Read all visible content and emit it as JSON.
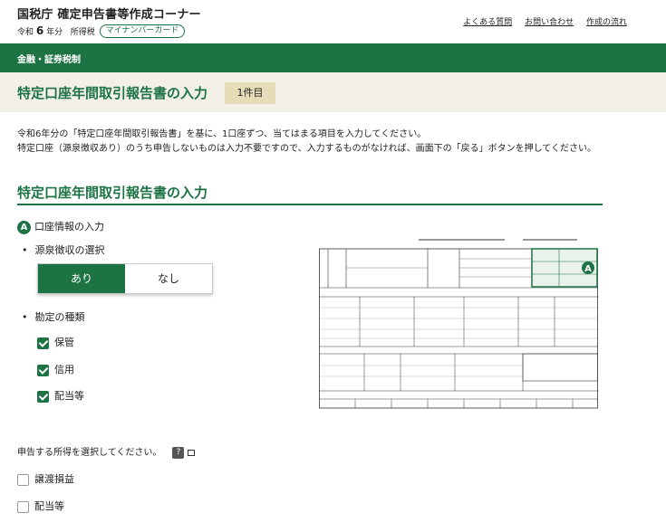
{
  "header": {
    "site_title": "国税庁 確定申告書等作成コーナー",
    "era": "令和",
    "year": "6",
    "year_suffix": "年分",
    "tax_type": "所得税",
    "mynumber_label": "マイナンバーカード",
    "links": [
      "よくある質問",
      "お問い合わせ",
      "作成の流れ"
    ]
  },
  "nav": {
    "category": "金融・証券税制"
  },
  "page": {
    "title": "特定口座年間取引報告書の入力",
    "count": "1件目"
  },
  "intro": {
    "line1": "令和6年分の「特定口座年間取引報告書」を基に、1口座ずつ、当てはまる項目を入力してください。",
    "line2": "特定口座（源泉徴収あり）のうち申告しないものは入力不要ですので、入力するものがなければ、画面下の「戻る」ボタンを押してください。"
  },
  "section": {
    "title": "特定口座年間取引報告書の入力",
    "step_badge": "A",
    "step_label": "口座情報の入力"
  },
  "withholding": {
    "label": "源泉徴収の選択",
    "options": [
      "あり",
      "なし"
    ],
    "selected": "あり"
  },
  "account": {
    "label": "勘定の種類",
    "items": [
      {
        "label": "保管",
        "checked": true
      },
      {
        "label": "信用",
        "checked": true
      },
      {
        "label": "配当等",
        "checked": true
      }
    ]
  },
  "income": {
    "question": "申告する所得を選択してください。",
    "help_icon": "?",
    "options": [
      {
        "label": "譲渡損益",
        "checked": false
      },
      {
        "label": "配当等",
        "checked": false
      }
    ]
  },
  "colors": {
    "accent": "#1e7345",
    "band": "#f3f0e8",
    "badge": "#e6dcb8"
  },
  "icons": [
    "help-icon",
    "external-link-icon",
    "check-icon",
    "form-image"
  ]
}
